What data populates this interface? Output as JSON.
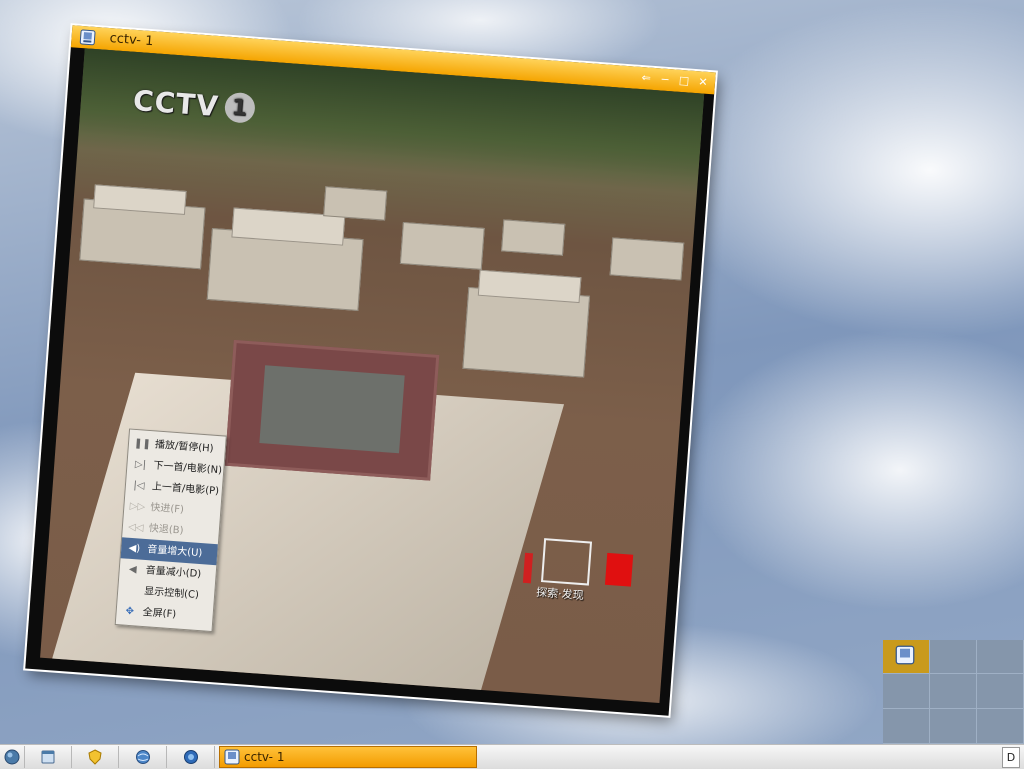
{
  "window": {
    "title": "cctv- 1",
    "buttons": {
      "restore": "⇐",
      "minimize": "−",
      "maximize": "□",
      "close": "✕"
    }
  },
  "video": {
    "channel_logo_text": "CCTV",
    "channel_logo_number": "1",
    "program_caption": "探索·发现"
  },
  "context_menu": {
    "items": [
      {
        "label": "播放/暂停(H)",
        "icon": "pause-icon",
        "glyph": "❚❚",
        "state": "normal"
      },
      {
        "label": "下一首/电影(N)",
        "icon": "next-icon",
        "glyph": "▷|",
        "state": "normal"
      },
      {
        "label": "上一首/电影(P)",
        "icon": "prev-icon",
        "glyph": "|◁",
        "state": "normal"
      },
      {
        "label": "快进(F)",
        "icon": "fast-forward-icon",
        "glyph": "▷▷",
        "state": "disabled"
      },
      {
        "label": "快退(B)",
        "icon": "rewind-icon",
        "glyph": "◁◁",
        "state": "disabled"
      },
      {
        "label": "音量增大(U)",
        "icon": "volume-up-icon",
        "glyph": "◀)",
        "state": "selected"
      },
      {
        "label": "音量减小(D)",
        "icon": "volume-down-icon",
        "glyph": "◀",
        "state": "normal"
      },
      {
        "label": "显示控制(C)",
        "icon": "",
        "glyph": "",
        "state": "normal"
      },
      {
        "label": "全屏(F)",
        "icon": "fullscreen-icon",
        "glyph": "✥",
        "state": "normal"
      }
    ]
  },
  "taskbar": {
    "launchers": [
      {
        "name": "system-menu",
        "glyph": "●"
      },
      {
        "name": "file-manager",
        "glyph": "▤"
      },
      {
        "name": "shield-app",
        "glyph": "⛨"
      },
      {
        "name": "network-browser",
        "glyph": "◍"
      },
      {
        "name": "web-browser",
        "glyph": "◉"
      }
    ],
    "active_task_label": "cctv- 1",
    "tray_text": "D"
  },
  "colors": {
    "title_bar": "#f5a400",
    "menu_selected": "#4c6c98",
    "pager_active": "#c99a1c"
  }
}
